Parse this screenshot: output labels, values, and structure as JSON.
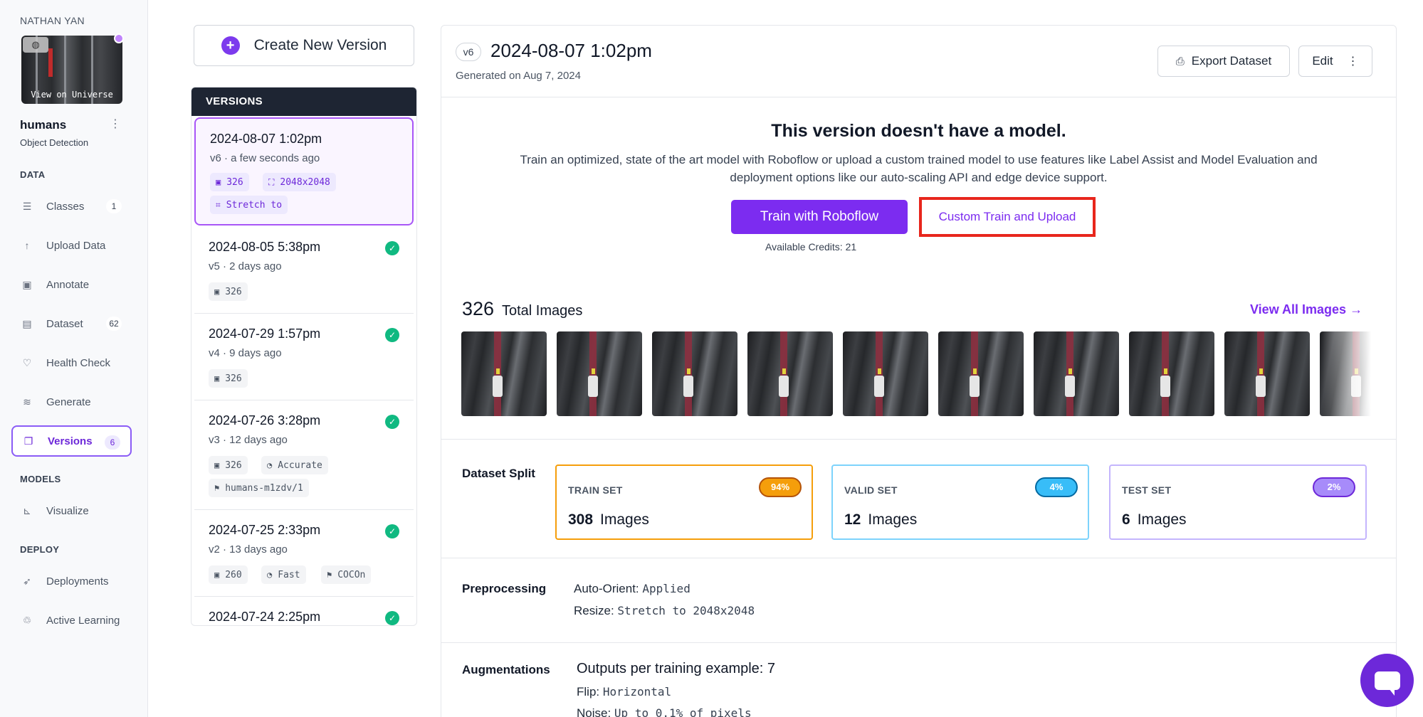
{
  "sidebar": {
    "workspace_name": "NATHAN YAN",
    "thumbnail_caption": "View on Universe",
    "project_name": "humans",
    "project_type": "Object Detection",
    "sections": {
      "data": "DATA",
      "models": "MODELS",
      "deploy": "DEPLOY"
    },
    "items": [
      {
        "label": "Classes",
        "icon": "list-icon",
        "count": "1"
      },
      {
        "label": "Upload Data",
        "icon": "upload-arrow-icon",
        "count": ""
      },
      {
        "label": "Annotate",
        "icon": "annotate-image-icon",
        "count": ""
      },
      {
        "label": "Dataset",
        "icon": "images-icon",
        "count": "62"
      },
      {
        "label": "Health Check",
        "icon": "heart-pulse-icon",
        "count": ""
      },
      {
        "label": "Generate",
        "icon": "layers-icon",
        "count": ""
      },
      {
        "label": "Versions",
        "icon": "folder-icon",
        "count": "6"
      },
      {
        "label": "Visualize",
        "icon": "chart-icon",
        "count": ""
      },
      {
        "label": "Deployments",
        "icon": "rocket-icon",
        "count": ""
      },
      {
        "label": "Active Learning",
        "icon": "recycle-icon",
        "count": ""
      }
    ]
  },
  "versions": {
    "create_label": "Create New Version",
    "header": "VERSIONS",
    "list": [
      {
        "name": "2024-08-07 1:02pm",
        "sub": "v6 · a few seconds ago",
        "chips": [
          "326",
          "2048x2048",
          "Stretch to"
        ]
      },
      {
        "name": "2024-08-05 5:38pm",
        "sub": "v5 · 2 days ago",
        "chips": [
          "326"
        ]
      },
      {
        "name": "2024-07-29 1:57pm",
        "sub": "v4 · 9 days ago",
        "chips": [
          "326"
        ]
      },
      {
        "name": "2024-07-26 3:28pm",
        "sub": "v3 · 12 days ago",
        "chips": [
          "326",
          "Accurate",
          "humans-m1zdv/1"
        ]
      },
      {
        "name": "2024-07-25 2:33pm",
        "sub": "v2 · 13 days ago",
        "chips": [
          "260",
          "Fast",
          "COCOn"
        ]
      },
      {
        "name": "2024-07-24 2:25pm",
        "sub": "",
        "chips": []
      }
    ]
  },
  "main": {
    "version_badge": "v6",
    "title": "2024-08-07 1:02pm",
    "generated": "Generated on Aug 7, 2024",
    "export_label": "Export Dataset",
    "edit_label": "Edit",
    "no_model_title": "This version doesn't have a model.",
    "no_model_desc": "Train an optimized, state of the art model with Roboflow or upload a custom trained model to use features like Label Assist and Model Evaluation and deployment options like our auto-scaling API and edge device support.",
    "train_label": "Train with Roboflow",
    "custom_label": "Custom Train and Upload",
    "credits_label": "Available Credits:",
    "credits_value": "21",
    "total_images_num": "326",
    "total_images_label": "Total Images",
    "view_all": "View All Images →",
    "split_label": "Dataset Split",
    "split": [
      {
        "name": "TRAIN SET",
        "pct": "94%",
        "num": "308",
        "unit": "Images",
        "color": "#f59e0b"
      },
      {
        "name": "VALID SET",
        "pct": "4%",
        "num": "12",
        "unit": "Images",
        "color": "#38bdf8"
      },
      {
        "name": "TEST SET",
        "pct": "2%",
        "num": "6",
        "unit": "Images",
        "color": "#a78bfa"
      }
    ],
    "preprocessing_label": "Preprocessing",
    "preprocessing": [
      {
        "key": "Auto-Orient:",
        "value": "Applied"
      },
      {
        "key": "Resize:",
        "value": "Stretch to 2048x2048"
      }
    ],
    "augmentations_label": "Augmentations",
    "augmentations_head": "Outputs per training example: 7",
    "augmentations": [
      {
        "key": "Flip:",
        "value": "Horizontal"
      },
      {
        "key": "Noise:",
        "value": "Up to 0.1% of pixels"
      }
    ]
  }
}
